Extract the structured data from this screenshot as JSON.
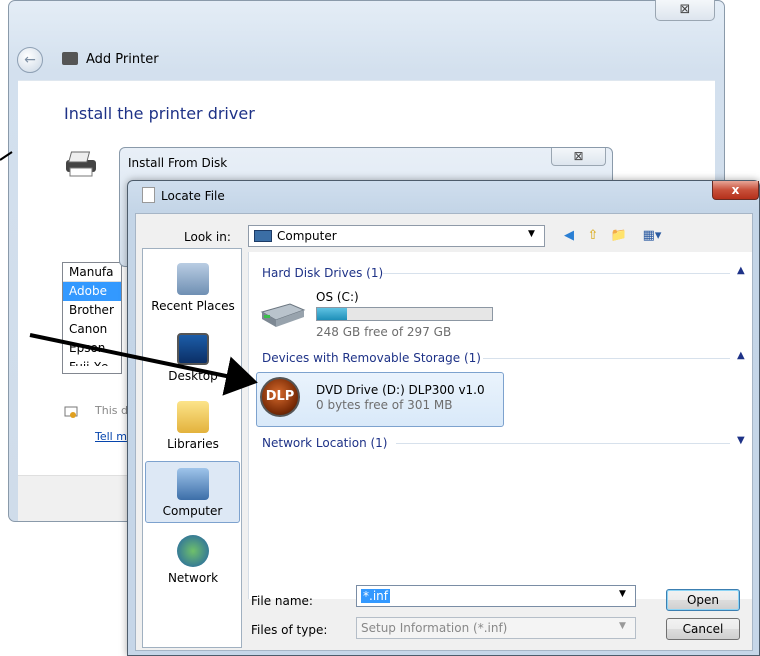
{
  "add_printer": {
    "title": "Add Printer",
    "close_glyph": "⊠",
    "heading": "Install the printer driver",
    "manufacturers": [
      "Manufa",
      "Adobe",
      "Brother",
      "Canon",
      "Epson",
      "Fuji Xe"
    ],
    "selected_index": 1,
    "warning_text": "This d",
    "tell_link": "Tell m"
  },
  "install_from_disk": {
    "title": "Install From Disk",
    "close_glyph": "⊠"
  },
  "locate_file": {
    "title": "Locate File",
    "close_glyph": "x",
    "look_in_label": "Look in:",
    "look_in_value": "Computer",
    "places": [
      "Recent Places",
      "Desktop",
      "Libraries",
      "Computer",
      "Network"
    ],
    "groups": [
      {
        "name": "Hard Disk Drives (1)",
        "expanded": true
      },
      {
        "name": "Devices with Removable Storage (1)",
        "expanded": true
      },
      {
        "name": "Network Location (1)",
        "expanded": false
      }
    ],
    "drives": {
      "os_name": "OS (C:)",
      "os_free": "248 GB free of 297 GB",
      "os_used_fraction": 0.17,
      "dvd_name": "DVD Drive (D:) DLP300 v1.0",
      "dvd_free": "0 bytes free of 301 MB",
      "dvd_logo": "DLP"
    },
    "file_name_label": "File name:",
    "file_name_value": "*.inf",
    "files_of_type_label": "Files of type:",
    "files_of_type_value": "Setup Information (*.inf)",
    "open_label": "Open",
    "cancel_label": "Cancel"
  },
  "colors": {
    "accent": "#1e3287",
    "close_red": "#c8503a",
    "selection": "#3399ff"
  }
}
